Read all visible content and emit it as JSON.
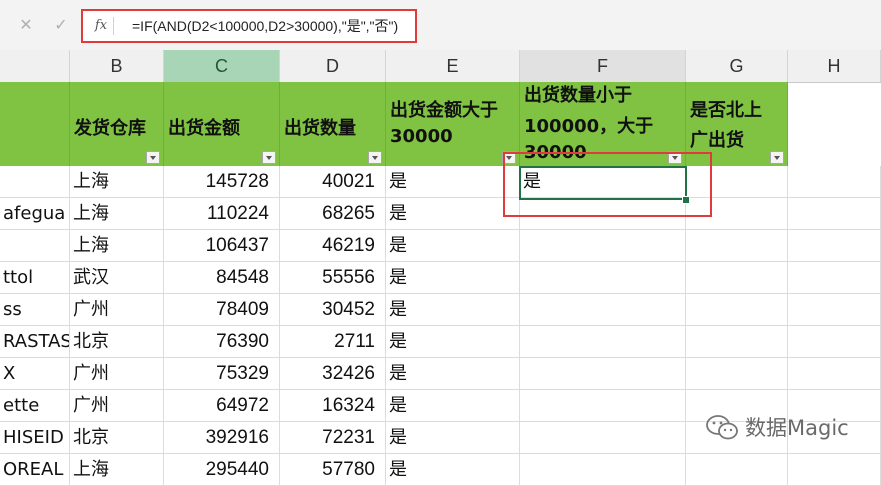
{
  "formula_bar": {
    "cancel": "✕",
    "enter": "✓",
    "fx": "fx",
    "formula": "=IF(AND(D2<100000,D2>30000),\"是\",\"否\")"
  },
  "columns": [
    "B",
    "C",
    "D",
    "E",
    "F",
    "G",
    "H"
  ],
  "headers": {
    "A": "",
    "B": "发货仓库",
    "C": "出货金额",
    "D": "出货数量",
    "E": [
      "出货金额大于",
      "30000"
    ],
    "F": [
      "出货数量小于",
      "100000，大于",
      "30000"
    ],
    "G": [
      "是否北上",
      "广出货"
    ]
  },
  "rows": [
    {
      "a": "",
      "b": "上海",
      "c": "145728",
      "d": "40021",
      "e": "是",
      "f": "是"
    },
    {
      "a": "afegua",
      "b": "上海",
      "c": "110224",
      "d": "68265",
      "e": "是",
      "f": ""
    },
    {
      "a": "",
      "b": "上海",
      "c": "106437",
      "d": "46219",
      "e": "是",
      "f": ""
    },
    {
      "a": "ttol",
      "b": "武汉",
      "c": "84548",
      "d": "55556",
      "e": "是",
      "f": ""
    },
    {
      "a": "ss",
      "b": "广州",
      "c": "78409",
      "d": "30452",
      "e": "是",
      "f": ""
    },
    {
      "a": "RASTAS",
      "b": "北京",
      "c": "76390",
      "d": "2711",
      "e": "是",
      "f": ""
    },
    {
      "a": "X",
      "b": "广州",
      "c": "75329",
      "d": "32426",
      "e": "是",
      "f": ""
    },
    {
      "a": "ette",
      "b": "广州",
      "c": "64972",
      "d": "16324",
      "e": "是",
      "f": ""
    },
    {
      "a": "HISEID",
      "b": "北京",
      "c": "392916",
      "d": "72231",
      "e": "是",
      "f": ""
    },
    {
      "a": "OREAL",
      "b": "上海",
      "c": "295440",
      "d": "57780",
      "e": "是",
      "f": ""
    }
  ],
  "watermark": "数据Magic",
  "colors": {
    "header_fill": "#80c242",
    "selected_col": "#a8d5b5",
    "active_border": "#217346",
    "highlight_box": "#e03b3b"
  }
}
